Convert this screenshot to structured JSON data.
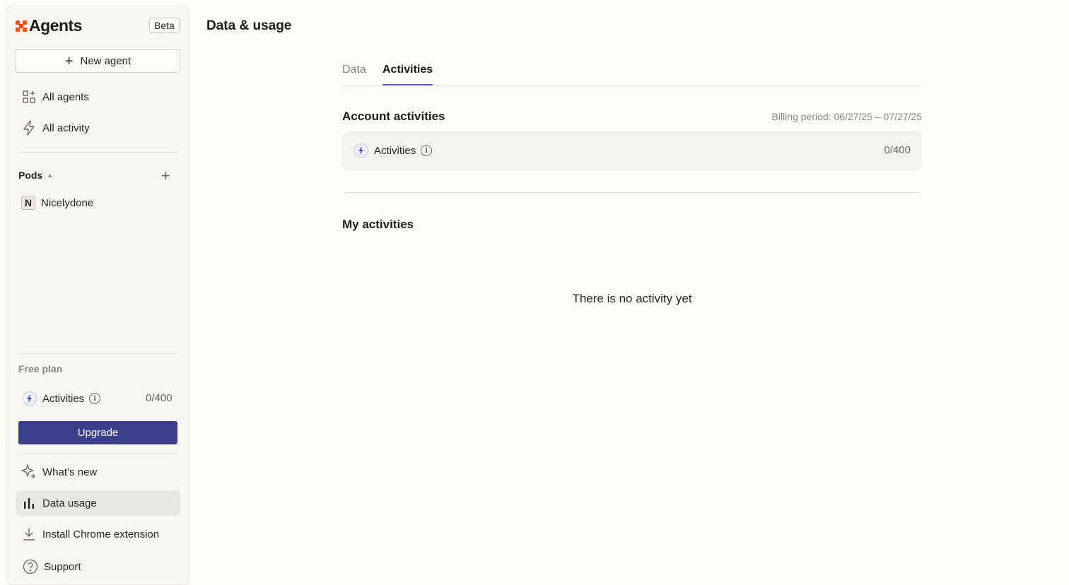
{
  "sidebar": {
    "brand": "Agents",
    "beta": "Beta",
    "new_agent": "New agent",
    "nav": [
      {
        "label": "All agents",
        "icon": "grid-icon"
      },
      {
        "label": "All activity",
        "icon": "lightning-icon"
      }
    ],
    "pods": {
      "title": "Pods",
      "items": [
        {
          "initial": "N",
          "label": "Nicelydone"
        }
      ]
    },
    "plan": {
      "label": "Free plan",
      "activities_label": "Activities",
      "activities_count": "0/400",
      "upgrade": "Upgrade"
    },
    "footer": [
      {
        "label": "What’s new",
        "icon": "sparkle-icon"
      },
      {
        "label": "Data usage",
        "icon": "bar-chart-icon",
        "active": true
      },
      {
        "label": "Install Chrome extension",
        "icon": "download-icon"
      },
      {
        "label": "Support",
        "icon": "help-icon"
      }
    ]
  },
  "main": {
    "title": "Data & usage",
    "tabs": [
      {
        "label": "Data",
        "active": false
      },
      {
        "label": "Activities",
        "active": true
      }
    ],
    "account": {
      "title": "Account activities",
      "billing": "Billing period: 06/27/25 – 07/27/25",
      "activities_label": "Activities",
      "activities_count": "0/400"
    },
    "mine": {
      "title": "My activities",
      "empty": "There is no activity yet"
    }
  },
  "colors": {
    "brand": "#ff4f00",
    "accent": "#3a3e8c",
    "tab_underline": "#5558c9"
  }
}
